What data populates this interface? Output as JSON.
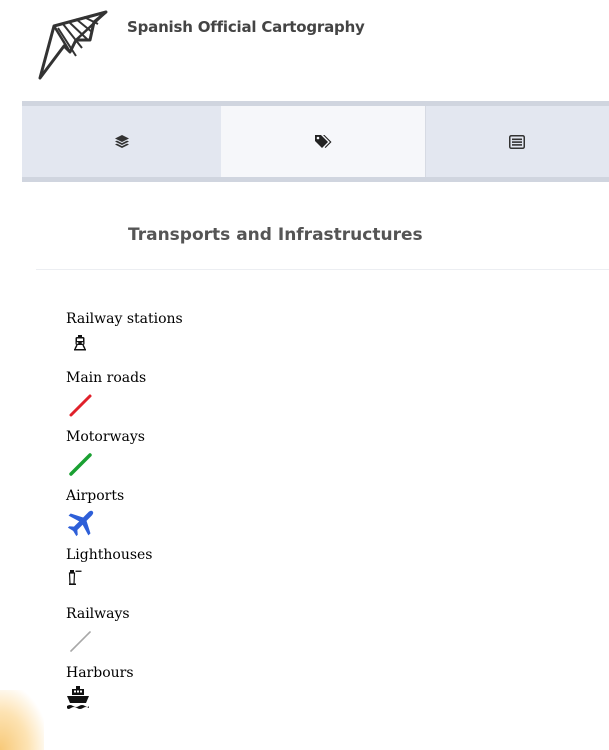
{
  "app": {
    "title": "Spanish Official Cartography"
  },
  "tabs": [
    {
      "icon": "layers-icon"
    },
    {
      "icon": "tags-icon",
      "active": true
    },
    {
      "icon": "list-icon"
    }
  ],
  "panel": {
    "title": "Transports and Infrastructures",
    "legend": [
      {
        "label": "Railway stations",
        "icon": "train-icon"
      },
      {
        "label": "Main roads",
        "icon": "line-red",
        "color": "#e0202a"
      },
      {
        "label": "Motorways",
        "icon": "line-green",
        "color": "#1aa032"
      },
      {
        "label": "Airports",
        "icon": "airplane-icon",
        "color": "#2e5fd8"
      },
      {
        "label": "Lighthouses",
        "icon": "lighthouse-icon"
      },
      {
        "label": "Railways",
        "icon": "line-gray",
        "color": "#a8a8a8"
      },
      {
        "label": "Harbours",
        "icon": "ship-icon"
      }
    ]
  }
}
